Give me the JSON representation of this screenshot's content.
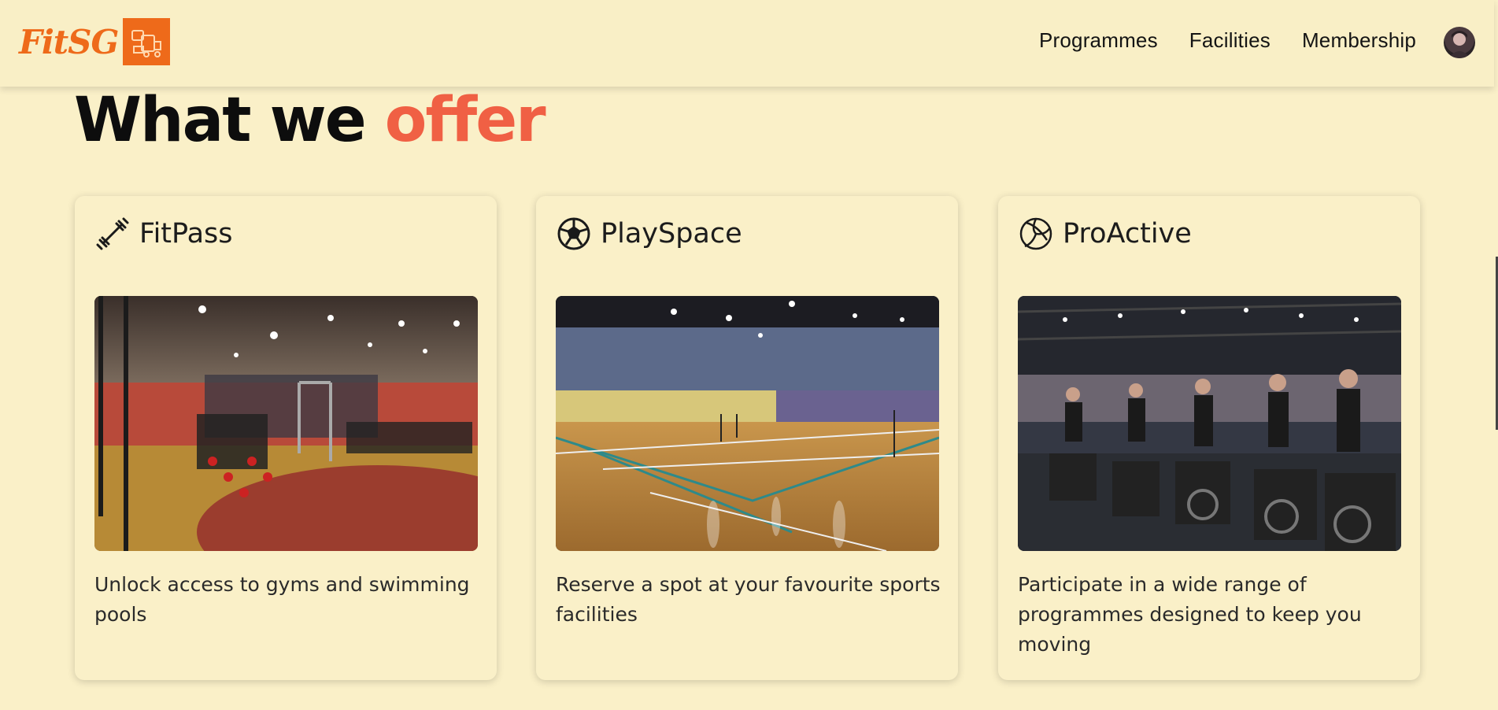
{
  "brand": {
    "logo_text": "FitSG"
  },
  "nav": {
    "links": [
      "Programmes",
      "Facilities",
      "Membership"
    ]
  },
  "heading": {
    "part1": "What we ",
    "part2": "offer"
  },
  "cards": [
    {
      "title": "FitPass",
      "icon": "dumbbell-icon",
      "description": "Unlock access to gyms and swimming pools"
    },
    {
      "title": "PlaySpace",
      "icon": "soccer-ball-icon",
      "description": "Reserve a spot at your favourite sports facilities"
    },
    {
      "title": "ProActive",
      "icon": "volleyball-icon",
      "description": "Participate in a wide range of programmes designed to keep you moving"
    }
  ],
  "colors": {
    "background": "#faf0c8",
    "brand_orange": "#ee6a1a",
    "accent": "#f06044"
  }
}
